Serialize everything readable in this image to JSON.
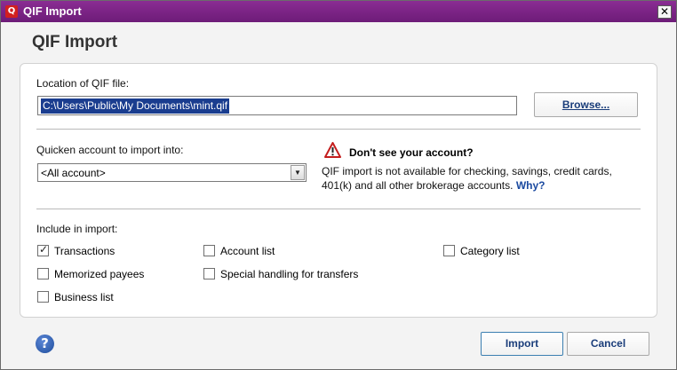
{
  "window": {
    "title": "QIF Import",
    "close_glyph": "✕"
  },
  "heading": "QIF Import",
  "location": {
    "label": "Location of QIF file:",
    "path_value": "C:\\Users\\Public\\My Documents\\mint.qif",
    "browse_label": "Browse..."
  },
  "account": {
    "label": "Quicken account to import into:",
    "selected": "<All account>"
  },
  "warning": {
    "title": "Don't see your account?",
    "text": "QIF import is not available for checking, savings, credit cards, 401(k) and all other brokerage accounts.",
    "link": "Why?"
  },
  "include": {
    "label": "Include in import:",
    "options": [
      {
        "label": "Transactions",
        "checked": true
      },
      {
        "label": "Account list",
        "checked": false
      },
      {
        "label": "Category list",
        "checked": false
      },
      {
        "label": "Memorized payees",
        "checked": false
      },
      {
        "label": "Special handling for transfers",
        "checked": false
      },
      {
        "label": "Business list",
        "checked": false
      }
    ]
  },
  "footer": {
    "help_glyph": "?",
    "import_label": "Import",
    "cancel_label": "Cancel"
  },
  "colors": {
    "titlebar": "#7a2384",
    "link": "#1b4aa0",
    "selection": "#1a3d8f"
  }
}
